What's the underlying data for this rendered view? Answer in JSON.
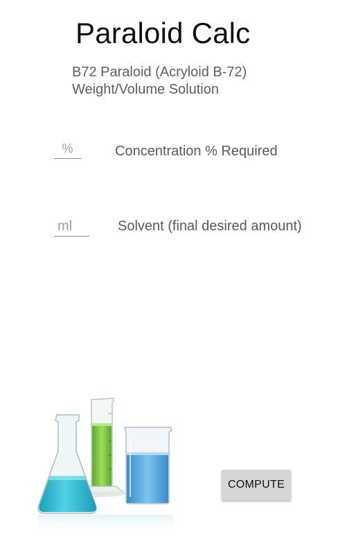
{
  "app": {
    "title": "Paraloid Calc",
    "subtitle_line1": "B72 Paraloid (Acryloid B-72)",
    "subtitle_line2": "Weight/Volume Solution"
  },
  "concentration": {
    "placeholder": "%",
    "value": "",
    "label": "Concentration % Required"
  },
  "solvent": {
    "placeholder": "ml",
    "value": "",
    "label": "Solvent (final desired amount)"
  },
  "image": {
    "icon": "lab-glassware-image",
    "colors": {
      "flask_liquid": "#3fc3d8",
      "cylinder_liquid": "#7ac943",
      "beaker_liquid": "#5aaee0"
    }
  },
  "compute_button": {
    "label": "COMPUTE",
    "background": "#d6d6d6"
  }
}
